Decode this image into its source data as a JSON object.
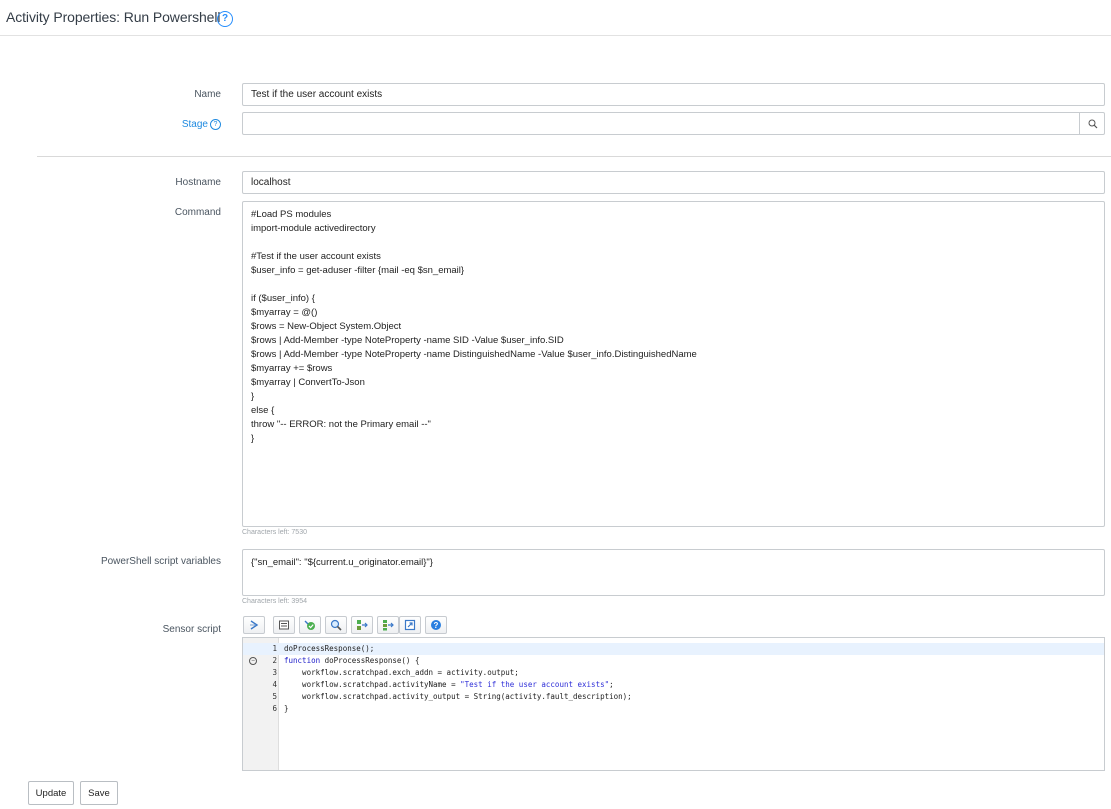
{
  "header": {
    "title": "Activity Properties: Run Powershell",
    "help_glyph": "?"
  },
  "form": {
    "name": {
      "label": "Name",
      "value": "Test if the user account exists"
    },
    "stage": {
      "label": "Stage",
      "help_glyph": "?",
      "value": ""
    },
    "hostname": {
      "label": "Hostname",
      "value": "localhost"
    },
    "command": {
      "label": "Command",
      "value": "#Load PS modules\nimport-module activedirectory\n\n#Test if the user account exists\n$user_info = get-aduser -filter {mail -eq $sn_email}\n\nif ($user_info) {\n$myarray = @()\n$rows = New-Object System.Object\n$rows | Add-Member -type NoteProperty -name SID -Value $user_info.SID\n$rows | Add-Member -type NoteProperty -name DistinguishedName -Value $user_info.DistinguishedName\n$myarray += $rows\n$myarray | ConvertTo-Json\n}\nelse {\nthrow \"-- ERROR: not the Primary email --\"\n}",
      "chars_left": "Characters left: 7530"
    },
    "ps_vars": {
      "label": "PowerShell script variables",
      "value": "{\"sn_email\": \"${current.u_originator.email}\"}",
      "chars_left": "Characters left: 3954"
    },
    "sensor": {
      "label": "Sensor script",
      "toolbar": [
        "format-code-icon",
        "comment-icon",
        "syntax-check-icon",
        "search-icon",
        "replace-icon",
        "replace-all-icon",
        "fullscreen-icon",
        "help-icon"
      ],
      "lines": [
        {
          "n": "1",
          "pre": "",
          "kw": "",
          "text": "doProcessResponse();"
        },
        {
          "n": "2",
          "pre": "",
          "kw": "function",
          "text": " doProcessResponse() {"
        },
        {
          "n": "3",
          "pre": "",
          "kw": "",
          "text": "    workflow.scratchpad.exch_addn = activity.output;"
        },
        {
          "n": "4",
          "pre": "    workflow.scratchpad.activityName = ",
          "kw": "",
          "str": "\"Test if the user account exists\"",
          "text": ";"
        },
        {
          "n": "5",
          "pre": "",
          "kw": "",
          "text": "    workflow.scratchpad.activity_output = String(activity.fault_description);"
        },
        {
          "n": "6",
          "pre": "",
          "kw": "",
          "text": "}"
        }
      ]
    }
  },
  "actions": {
    "update": "Update",
    "save": "Save"
  },
  "colors": {
    "accent": "#278efc",
    "border": "#c8ccd0"
  }
}
